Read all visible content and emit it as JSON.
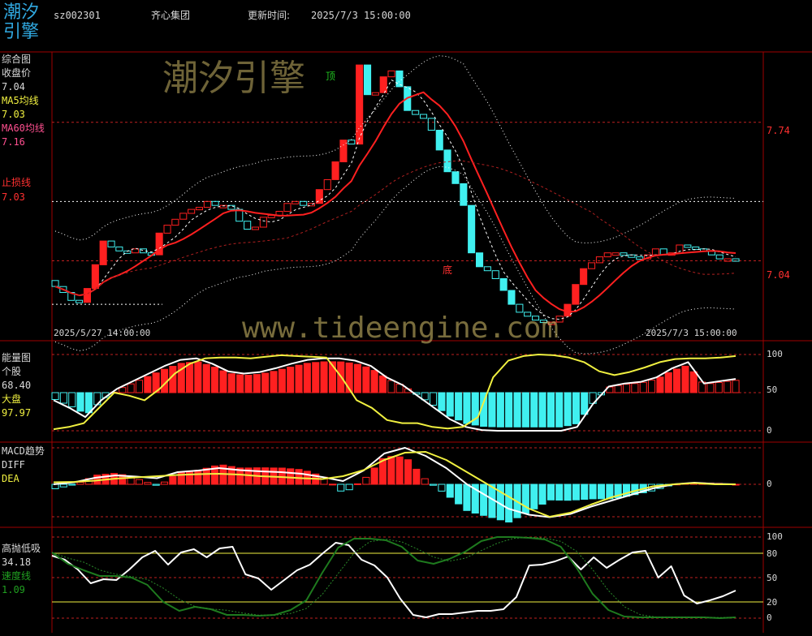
{
  "header": {
    "logo_text": "潮汐引擎",
    "code": "sz002301",
    "name": "齐心集团",
    "update_label": "更新时间:",
    "update_time": "2025/7/3 15:00:00"
  },
  "panels": {
    "main": {
      "title": "综合图",
      "close_label": "收盘价",
      "close_value": "7.04",
      "ma5_label": "MA5均线",
      "ma5_value": "7.03",
      "ma60_label": "MA60均线",
      "ma60_value": "7.16",
      "stop_label": "止损线",
      "stop_value": "7.03",
      "price_ticks": [
        "7.74",
        "7.04"
      ],
      "top_marker": "顶",
      "bottom_marker": "底",
      "date_start": "2025/5/27 14:00:00",
      "date_end": "2025/7/3 15:00:00"
    },
    "energy": {
      "title": "能量图",
      "stock_label": "个股",
      "stock_value": "68.40",
      "market_label": "大盘",
      "market_value": "97.97",
      "ticks": [
        "100",
        "50",
        "0"
      ]
    },
    "macd": {
      "title": "MACD趋势",
      "diff_label": "DIFF",
      "dea_label": "DEA",
      "ticks": [
        "0"
      ]
    },
    "gaopao": {
      "title": "高抛低吸",
      "value": "34.18",
      "speed_label": "速度线",
      "speed_value": "1.09",
      "ticks": [
        "100",
        "80",
        "50",
        "20",
        "0"
      ]
    }
  },
  "watermarks": {
    "brand": "潮汐引擎",
    "url": "www.tideengine.com"
  },
  "colors": {
    "up": "#ff2020",
    "down": "#40f0f0",
    "ma5": "#ffffff",
    "ma60": "#ff2020",
    "diff": "#ffffff",
    "dea": "#f0f040",
    "speed": "#1e7a1e",
    "axis": "#a00000"
  },
  "chart_data": {
    "type": "candlestick",
    "x_range": [
      "2025/5/27 14:00:00",
      "2025/7/3 15:00:00"
    ],
    "price_levels": [
      7.74,
      7.04
    ],
    "close_series": [
      6.91,
      6.88,
      6.84,
      6.83,
      6.9,
      7.02,
      7.14,
      7.11,
      7.09,
      7.08,
      7.1,
      7.08,
      7.07,
      7.18,
      7.22,
      7.25,
      7.28,
      7.3,
      7.31,
      7.34,
      7.32,
      7.32,
      7.3,
      7.24,
      7.2,
      7.21,
      7.26,
      7.27,
      7.29,
      7.33,
      7.34,
      7.32,
      7.33,
      7.4,
      7.45,
      7.54,
      7.65,
      7.63,
      8.03,
      7.88,
      7.89,
      7.97,
      8.0,
      7.92,
      7.8,
      7.78,
      7.76,
      7.7,
      7.6,
      7.49,
      7.43,
      7.32,
      7.08,
      7.01,
      6.99,
      6.95,
      6.89,
      6.82,
      6.78,
      6.76,
      6.74,
      6.73,
      6.73,
      6.76,
      6.82,
      6.92,
      7.0,
      7.03,
      7.06,
      7.08,
      7.08,
      7.07,
      7.06,
      7.05,
      7.07,
      7.1,
      7.07,
      7.08,
      7.12,
      7.11,
      7.1,
      7.09,
      7.07,
      7.05,
      7.05,
      7.04
    ],
    "energy": {
      "range": [
        0,
        100
      ],
      "stock": [
        40,
        30,
        18,
        40,
        55,
        65,
        75,
        85,
        93,
        95,
        88,
        78,
        75,
        77,
        82,
        88,
        93,
        95,
        95,
        92,
        85,
        70,
        60,
        45,
        30,
        15,
        5,
        1,
        0,
        0,
        0,
        0,
        0,
        5,
        35,
        58,
        62,
        64,
        70,
        82,
        90,
        62,
        65,
        68
      ],
      "market": [
        2,
        5,
        10,
        30,
        50,
        46,
        40,
        55,
        75,
        88,
        95,
        96,
        96,
        95,
        97,
        99,
        98,
        97,
        96,
        70,
        40,
        30,
        14,
        10,
        10,
        5,
        3,
        5,
        18,
        70,
        92,
        98,
        100,
        99,
        96,
        90,
        78,
        73,
        77,
        83,
        90,
        94,
        95,
        95,
        96,
        98
      ]
    },
    "macd": {
      "diff": [
        0.0,
        0.05,
        0.16,
        0.22,
        0.19,
        0.15,
        0.3,
        0.34,
        0.4,
        0.35,
        0.32,
        0.3,
        0.26,
        0.18,
        0.08,
        0.34,
        0.76,
        0.9,
        0.7,
        0.4,
        0.0,
        -0.3,
        -0.6,
        -0.75,
        -0.81,
        -0.73,
        -0.55,
        -0.4,
        -0.25,
        -0.1,
        0.0,
        0.04,
        0.01,
        0.0
      ],
      "dea": [
        0.05,
        0.06,
        0.09,
        0.14,
        0.17,
        0.2,
        0.23,
        0.25,
        0.26,
        0.24,
        0.2,
        0.18,
        0.15,
        0.13,
        0.2,
        0.35,
        0.6,
        0.78,
        0.8,
        0.6,
        0.3,
        0.0,
        -0.3,
        -0.6,
        -0.8,
        -0.7,
        -0.5,
        -0.32,
        -0.18,
        -0.05,
        0.0,
        0.03,
        0.0,
        0.0
      ]
    },
    "gaopao": {
      "range": [
        0,
        100
      ],
      "value": [
        77,
        72,
        60,
        43,
        48,
        47,
        60,
        75,
        83,
        66,
        81,
        85,
        75,
        86,
        88,
        54,
        49,
        35,
        47,
        59,
        66,
        80,
        93,
        90,
        72,
        65,
        50,
        24,
        4,
        1,
        5,
        5,
        7,
        9,
        9,
        11,
        26,
        65,
        66,
        70,
        76,
        60,
        75,
        62,
        72,
        81,
        83,
        50,
        64,
        28,
        18,
        22,
        27,
        34
      ],
      "speed": [
        81,
        67,
        59,
        52,
        52,
        50,
        41,
        20,
        9,
        14,
        11,
        4,
        4,
        3,
        4,
        10,
        22,
        56,
        87,
        98,
        98,
        96,
        88,
        71,
        67,
        73,
        82,
        95,
        100,
        100,
        99,
        97,
        88,
        62,
        30,
        10,
        2,
        1,
        1,
        1,
        1,
        1,
        0,
        1
      ]
    }
  }
}
